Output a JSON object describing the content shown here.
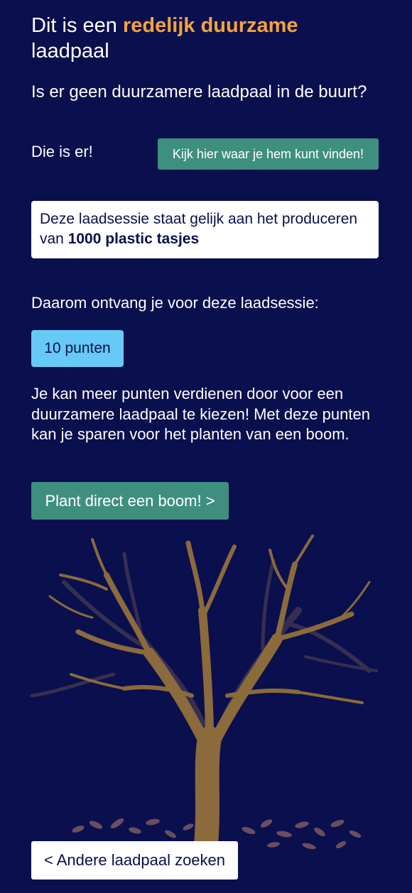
{
  "header": {
    "title_prefix": "Dit is een",
    "title_highlight": "redelijk duurzame",
    "title_suffix": "laadpaal"
  },
  "question": "Is er geen duurzamere laadpaal in de buurt?",
  "alternative": {
    "text": "Die is er!",
    "button_label": "Kijk hier waar je hem kunt vinden!"
  },
  "impact": {
    "text_prefix": "Deze laadsessie staat gelijk aan het produceren van",
    "text_bold": "1000 plastic tasjes"
  },
  "reward": {
    "intro": "Daarom ontvang je voor deze laadsessie:",
    "points_label": "10 punten"
  },
  "explanation": "Je kan meer punten verdienen door voor een duurzamere laadpaal te kiezen! Met deze punten kan je sparen voor het planten van een boom.",
  "plant_button_label": "Plant direct een boom! >",
  "back_button_label": "< Andere laadpaal zoeken",
  "colors": {
    "background": "#0a0f4e",
    "highlight": "#f5a23a",
    "green_button": "#3f8f7f",
    "points_badge": "#67c9f5",
    "tree_trunk": "#8b6a3c",
    "leaves": "#6b4e5e"
  },
  "illustration": "bare-tree-illustration"
}
